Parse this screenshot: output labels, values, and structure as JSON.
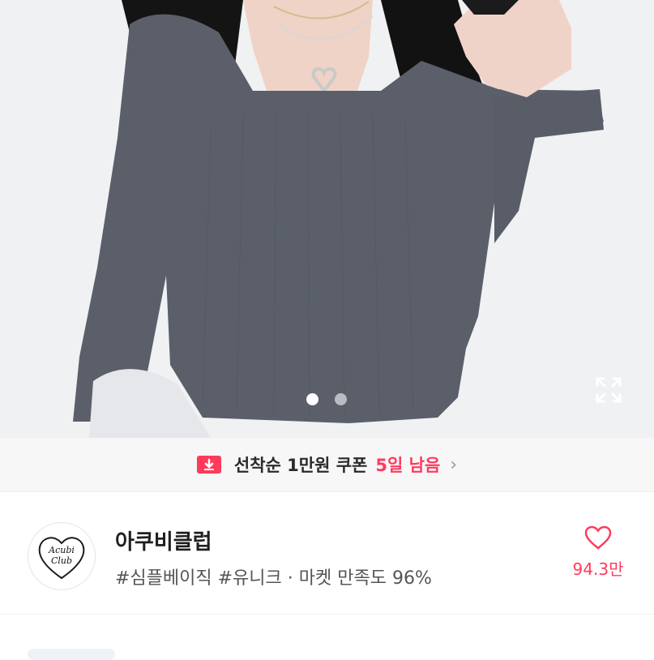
{
  "product_image": {
    "alt": "product photo",
    "carousel": {
      "total": 2,
      "active": 1
    }
  },
  "icons": {
    "expand": "expand-icon",
    "coupon": "coupon-download-icon",
    "chevron": "chevron-right-icon",
    "heart": "heart-icon"
  },
  "coupon_banner": {
    "text": "선착순 1만원 쿠폰",
    "days_left": "5일 남음"
  },
  "shop": {
    "logo_text_line1": "Acubi",
    "logo_text_line2": "Club",
    "name": "아쿠비클럽",
    "tags": "#심플베이직 #유니크 · 마켓 만족도 96%",
    "likes": "94.3만"
  },
  "colors": {
    "accent": "#ff3b5c",
    "text_primary": "#1f1f1f",
    "text_secondary": "#555555"
  }
}
